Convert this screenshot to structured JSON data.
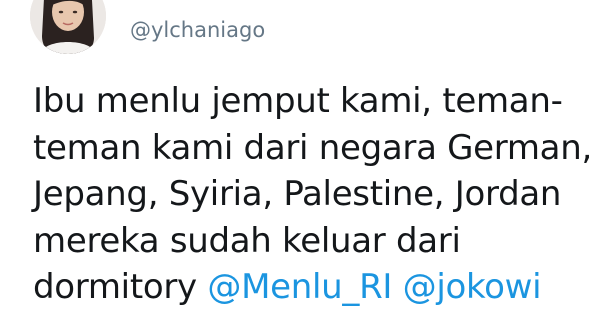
{
  "tweet": {
    "display_name": "",
    "handle": "@ylchaniago",
    "text_lines": [
      "Ibu menlu jemput kami, teman-",
      "teman kami dari negara German,",
      "Jepang, Syiria, Palestine, Jordan",
      "mereka sudah keluar dari"
    ],
    "last_line_text": "dormitory ",
    "mentions": [
      "@Menlu_RI",
      "@jokowi"
    ],
    "mention_color": "#1b95e0",
    "text_color": "#14171a",
    "handle_color": "#657786"
  }
}
